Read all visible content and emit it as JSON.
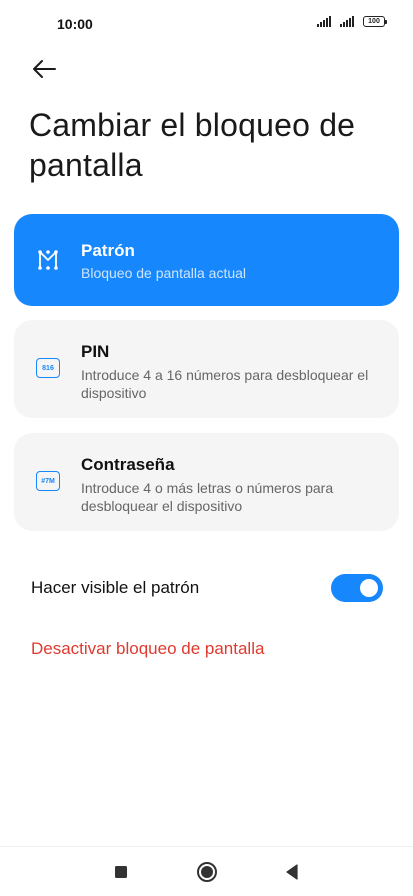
{
  "status_bar": {
    "time": "10:00",
    "battery": "100"
  },
  "header": {
    "back_icon": "arrow-left-icon",
    "title": "Cambiar el bloqueo de pantalla"
  },
  "options": [
    {
      "icon": "pattern-icon",
      "title": "Patrón",
      "subtitle": "Bloqueo de pantalla actual",
      "selected": true
    },
    {
      "icon": "pin-icon",
      "icon_text": "816",
      "title": "PIN",
      "subtitle": "Introduce 4 a 16 números para desbloquear el dispositivo",
      "selected": false
    },
    {
      "icon": "password-icon",
      "icon_text": "#7M",
      "title": "Contraseña",
      "subtitle": "Introduce 4 o más letras o números para desbloquear el dispositivo",
      "selected": false
    }
  ],
  "toggle": {
    "label": "Hacer visible el patrón",
    "on": true
  },
  "disable_link": "Desactivar bloqueo de pantalla",
  "nav": {
    "recent": "square-icon",
    "home": "circle-icon",
    "back": "triangle-back-icon"
  },
  "colors": {
    "accent": "#1687fc",
    "danger": "#e03a2f",
    "card": "#f5f5f5"
  }
}
